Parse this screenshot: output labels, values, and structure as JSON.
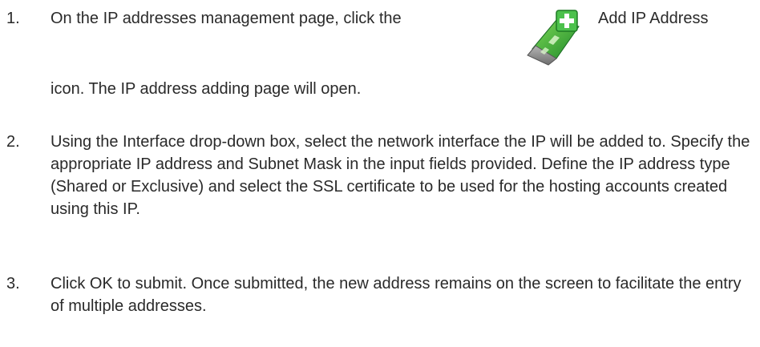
{
  "steps": [
    {
      "number": "1.",
      "text_before_icon": "On the IP addresses management page, click the",
      "icon": "add-ip-address-icon",
      "icon_label": "Add IP Address",
      "text_after_icon": "icon. The IP address adding page will open."
    },
    {
      "number": "2.",
      "text": "Using the Interface drop-down box, select the network interface the IP will be added to. Specify the appropriate IP address and Subnet Mask in the input fields provided. Define the IP address type (Shared or Exclusive) and select the SSL certificate to be used for the hosting accounts created using this IP."
    },
    {
      "number": "3.",
      "text": "Click OK to submit. Once submitted, the new address remains on the screen to facilitate the entry of multiple addresses."
    }
  ],
  "colors": {
    "text": "#2a2a2a",
    "icon_green": "#3aa83a",
    "icon_plus_box": "#5cc85c",
    "icon_card_gray": "#8c8c8c"
  }
}
